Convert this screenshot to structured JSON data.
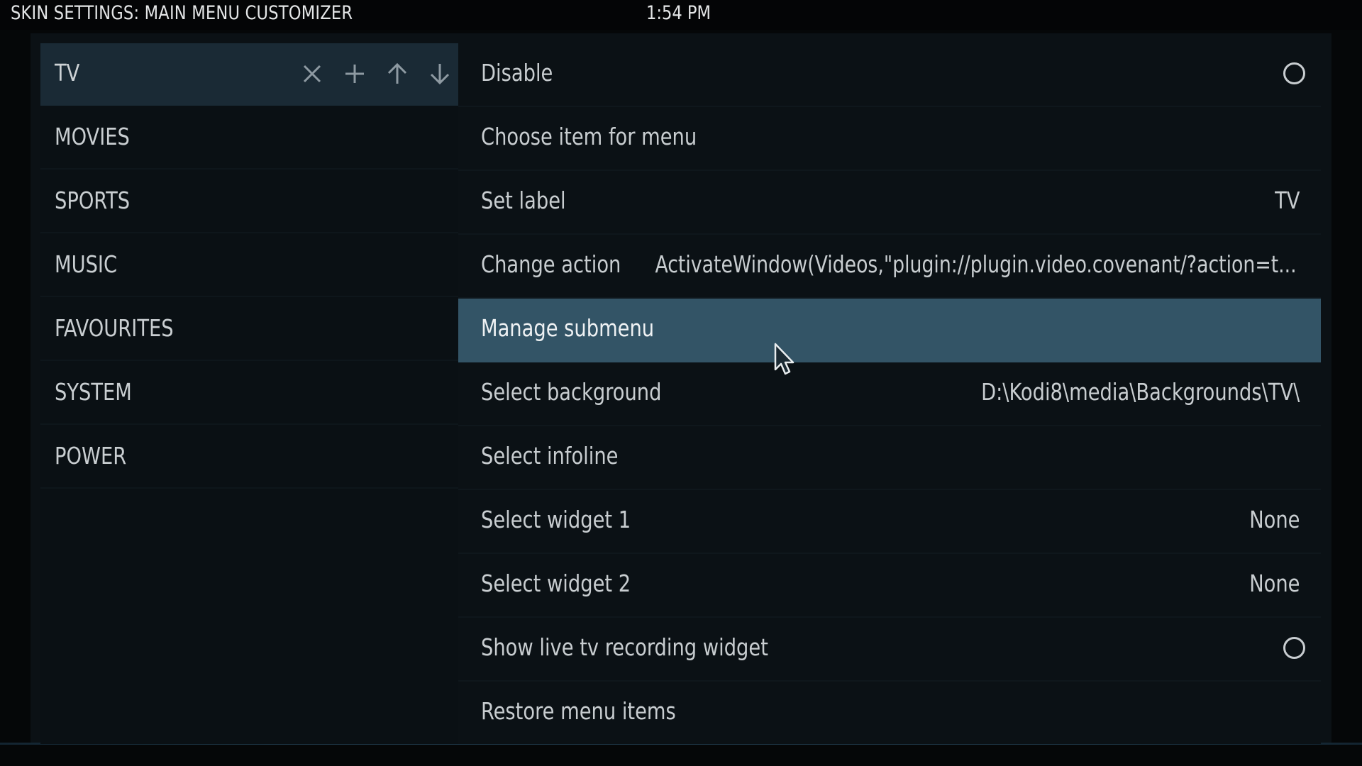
{
  "header": {
    "title": "SKIN SETTINGS: MAIN MENU CUSTOMIZER",
    "clock": "1:54 PM"
  },
  "menu_items": [
    {
      "label": "TV",
      "selected": true
    },
    {
      "label": "MOVIES",
      "selected": false
    },
    {
      "label": "SPORTS",
      "selected": false
    },
    {
      "label": "MUSIC",
      "selected": false
    },
    {
      "label": "FAVOURITES",
      "selected": false
    },
    {
      "label": "SYSTEM",
      "selected": false
    },
    {
      "label": "POWER",
      "selected": false
    }
  ],
  "item_tools": [
    "close-icon",
    "plus-icon",
    "arrow-up-icon",
    "arrow-down-icon"
  ],
  "options": [
    {
      "label": "Disable",
      "value": "",
      "control": "radio",
      "checked": false
    },
    {
      "label": "Choose item for menu",
      "value": ""
    },
    {
      "label": "Set label",
      "value": "TV"
    },
    {
      "label": "Change action",
      "value": "ActivateWindow(Videos,\"plugin://plugin.video.covenant/?action=t..."
    },
    {
      "label": "Manage submenu",
      "value": "",
      "selected": true
    },
    {
      "label": "Select background",
      "value": "D:\\Kodi8\\media\\Backgrounds\\TV\\"
    },
    {
      "label": "Select infoline",
      "value": ""
    },
    {
      "label": "Select widget 1",
      "value": "None"
    },
    {
      "label": "Select widget 2",
      "value": "None"
    },
    {
      "label": "Show live tv recording widget",
      "value": "",
      "control": "radio",
      "checked": false
    },
    {
      "label": "Restore menu items",
      "value": ""
    }
  ],
  "colors": {
    "background": "#0b1115",
    "selected_option": "#335466",
    "selected_menu_item": "#1a2a35",
    "text": "#c8cdd0"
  }
}
